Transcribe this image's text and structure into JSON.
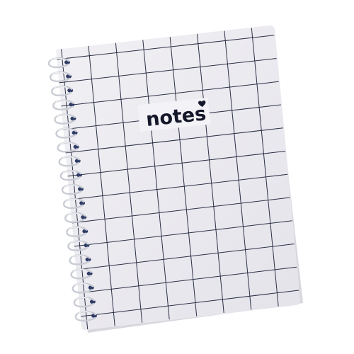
{
  "photo": {
    "subject": "spiral notebook",
    "cover_label": "notes",
    "label_ornament": "heart-icon",
    "colors": {
      "background": "#ffffff",
      "cover": "#ecebf0",
      "grid_line": "#2b3046",
      "text": "#15172a",
      "spiral_wire": "#c9ccd4",
      "punch_hole": "#2f3c66"
    },
    "grid": {
      "columns": 8,
      "rows": 12
    },
    "spiral_rings": 19
  }
}
